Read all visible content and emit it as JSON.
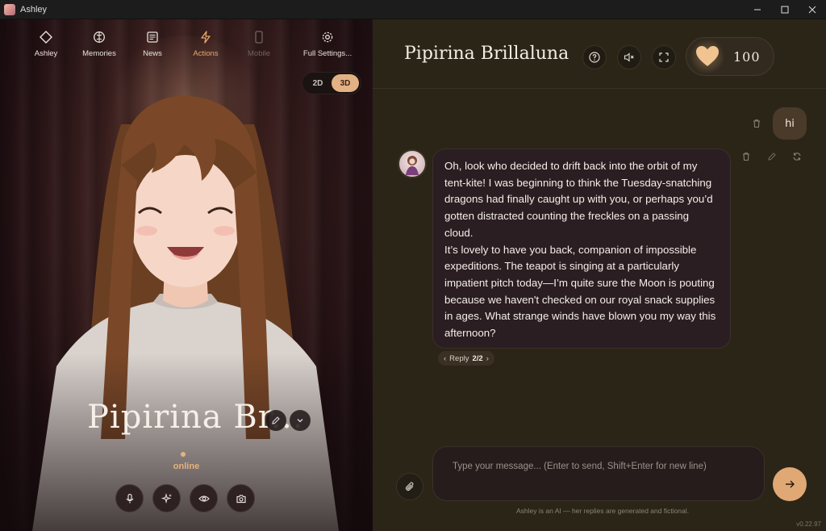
{
  "window": {
    "title": "Ashley"
  },
  "nav": [
    {
      "label": "Ashley",
      "icon": "diamond-icon"
    },
    {
      "label": "Memories",
      "icon": "brain-icon"
    },
    {
      "label": "News",
      "icon": "newspaper-icon"
    },
    {
      "label": "Actions",
      "icon": "lightning-icon"
    },
    {
      "label": "Mobile",
      "icon": "mobile-icon"
    },
    {
      "label": "Full Settings...",
      "icon": "gear-icon"
    }
  ],
  "view_toggle": {
    "options": [
      "2D",
      "3D"
    ],
    "selected": "3D"
  },
  "character": {
    "display_name": "Pipirina Br...",
    "status": "online"
  },
  "header": {
    "name": "Pipirina Brillaluna",
    "affection": "100"
  },
  "chat": {
    "user_message": "hi",
    "bot_message": "Oh, look who decided to drift back into the orbit of my tent-kite! I was beginning to think the Tuesday-snatching dragons had finally caught up with you, or perhaps you’d gotten distracted counting the freckles on a passing cloud.\nIt’s lovely to have you back, companion of impossible expeditions. The teapot is singing at a particularly impatient pitch today—I’m quite sure the Moon is pouting because we haven't checked on our royal snack supplies in ages. What strange winds have blown you my way this afternoon?",
    "reply_label": "Reply",
    "reply_index": "2/2"
  },
  "composer": {
    "placeholder": "Type your message...  (Enter to send, Shift+Enter for new line)"
  },
  "disclaimer": "Ashley is an AI — her replies are generated and fictional.",
  "version": "v0.22.97",
  "colors": {
    "accent": "#e0a874",
    "bg_right": "#2b2518",
    "bubble_bot": "#2b1e22"
  }
}
